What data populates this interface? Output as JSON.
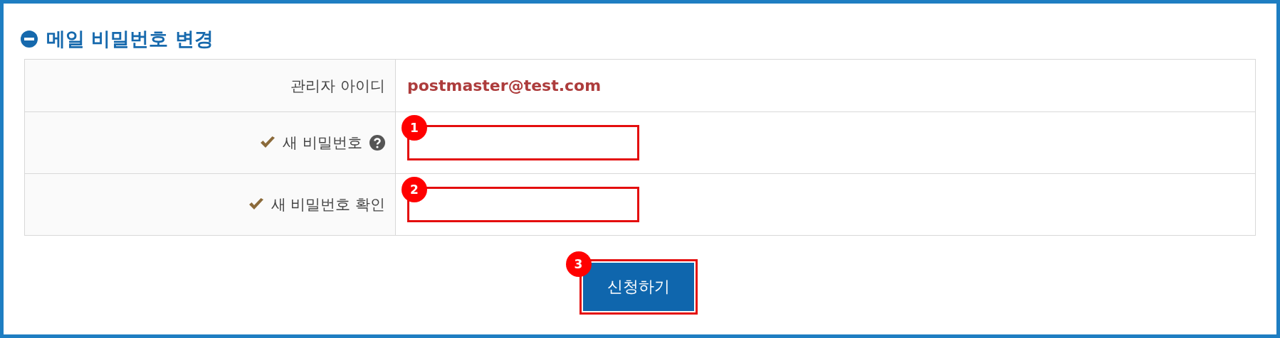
{
  "title": "메일 비밀번호 변경",
  "rows": [
    {
      "label": "관리자 아이디",
      "kind": "text",
      "value": "postmaster@test.com",
      "required": false,
      "help": false
    },
    {
      "label": "새 비밀번호",
      "kind": "input",
      "marker": "1",
      "required": true,
      "help": true
    },
    {
      "label": "새 비밀번호 확인",
      "kind": "input",
      "marker": "2",
      "required": true,
      "help": false
    }
  ],
  "submit": {
    "label": "신청하기",
    "marker": "3"
  }
}
